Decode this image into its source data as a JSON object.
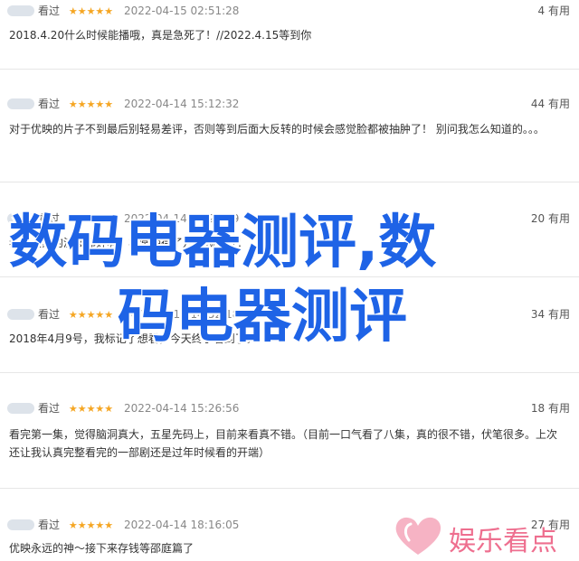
{
  "reviews": [
    {
      "user": "看过",
      "stars": "★★★★★",
      "time": "2022-04-15 02:51:28",
      "useful": "4 有用",
      "text": "2018.4.20什么时候能播哦，真是急死了！//2022.4.15等到你"
    },
    {
      "user": "看过",
      "stars": "★★★★★",
      "time": "2022-04-14 15:12:32",
      "useful": "44 有用",
      "text": "对于优映的片子不到最后别轻易差评，否则等到后面大反转的时候会感觉脸都被抽肿了！ 别问我怎么知道的。。。"
    },
    {
      "user": "看过",
      "stars": "★★★★★",
      "time": "2022-04-14 14:23:09",
      "useful": "20 有用",
      "text": "我，大家的演技都好啊，非常期待了儿子预告片！"
    },
    {
      "user": "看过",
      "stars": "★★★★★",
      "time": "2022-04-14 14:52:18",
      "useful": "34 有用",
      "text": "2018年4月9号，我标记了想看，今天终于看到了。"
    },
    {
      "user": "看过",
      "stars": "★★★★★",
      "time": "2022-04-14 15:26:56",
      "useful": "18 有用",
      "text": "看完第一集，觉得脑洞真大，五星先码上，目前来看真不错。（目前一口气看了八集，真的很不错，伏笔很多。上次还让我认真完整看完的一部剧还是过年时候看的开端）"
    },
    {
      "user": "看过",
      "stars": "★★★★★",
      "time": "2022-04-14 18:16:05",
      "useful": "27 有用",
      "text": "优映永远的神～接下来存钱等邵庭篇了"
    }
  ],
  "watermark": {
    "line1": "数码电器测评,数",
    "line2": "码电器测评"
  },
  "logo": {
    "text": "娱乐看点"
  },
  "colors": {
    "star": "#f5a623",
    "watermark": "#1e63e6",
    "logo": "#ee6f8f"
  }
}
